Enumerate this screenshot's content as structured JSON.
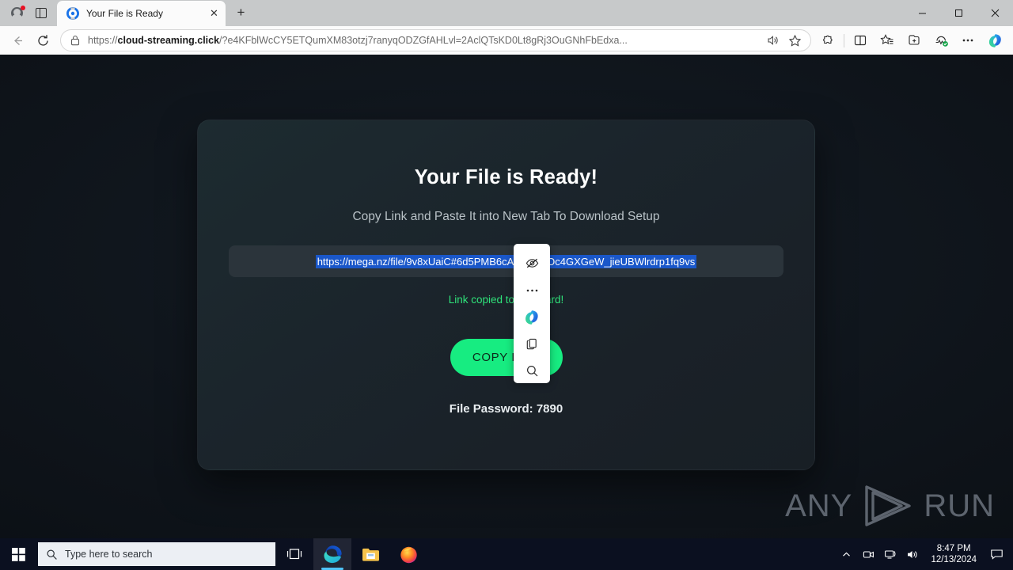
{
  "browser": {
    "tab": {
      "title": "Your File is Ready",
      "favicon": "sync-circle-icon",
      "close_label": "✕"
    },
    "newtab_label": "+",
    "window_controls": {
      "minimize": "–",
      "maximize": "❐",
      "close": "✕"
    },
    "address": {
      "url_prefix": "https://",
      "url_domain": "cloud-streaming.click",
      "url_path": "/?e4KFblWcCY5ETQumXM83otzj7ranyqODZGfAHLvl=2AclQTsKD0Lt8gRj3OuGNhFbEdxa...",
      "lock_icon": "lock-icon",
      "read_aloud_icon": "read-aloud-icon",
      "favorite_icon": "star-icon"
    },
    "toolbar_icons": [
      "extensions-icon",
      "split-screen-icon",
      "favorites-icon",
      "collections-icon",
      "browser-essentials-icon",
      "settings-more-icon",
      "copilot-icon"
    ],
    "nav": {
      "back_icon": "back-arrow-icon",
      "reload_icon": "reload-icon"
    },
    "profile": {
      "avatar": "account-avatar-icon",
      "badge": "alert-badge"
    },
    "tab_search_icon": "tab-actions-icon"
  },
  "page": {
    "title": "Your File is Ready!",
    "subtitle": "Copy Link and Paste It into New Tab To Download Setup",
    "link_value": "https://mega.nz/file/9v8xUaiC#6d5PMB6cALtZDuzOc4GXGeW_jieUBWlrdrp1fq9vs",
    "copied_message": "Link copied to clipboard!",
    "copy_button_label": "COPY LINK",
    "file_password": "File Password: 7890",
    "colors": {
      "accent_green": "#17ec81",
      "copied_green": "#2fe37a",
      "selection_blue": "#1a57c9",
      "card_bg": "#1b252c",
      "page_bg": "#0d1117"
    },
    "watermark": {
      "left": "ANY",
      "right": "RUN",
      "logo": "play-triangle-icon"
    }
  },
  "mini_menu": {
    "items": [
      {
        "name": "hide-icon",
        "label": "Hide"
      },
      {
        "name": "more-options-icon",
        "label": "•••"
      },
      {
        "name": "copilot-icon",
        "label": "Copilot"
      },
      {
        "name": "copy-icon",
        "label": "Copy"
      },
      {
        "name": "search-icon",
        "label": "Search"
      }
    ]
  },
  "taskbar": {
    "start_icon": "windows-start-icon",
    "search_placeholder": "Type here to search",
    "search_icon": "search-icon",
    "task_view_icon": "task-view-icon",
    "apps": [
      {
        "name": "edge-taskbar-icon",
        "label": "Microsoft Edge",
        "active": true
      },
      {
        "name": "file-explorer-taskbar-icon",
        "label": "File Explorer",
        "active": false
      },
      {
        "name": "firefox-taskbar-icon",
        "label": "Mozilla Firefox",
        "active": false
      }
    ],
    "tray": [
      {
        "name": "show-hidden-icons-icon",
        "label": "^"
      },
      {
        "name": "screen-recorder-icon",
        "label": "Recorder"
      },
      {
        "name": "network-icon",
        "label": "Network"
      },
      {
        "name": "volume-icon",
        "label": "Volume"
      }
    ],
    "time": "8:47 PM",
    "date": "12/13/2024",
    "notification_icon": "notification-icon"
  }
}
